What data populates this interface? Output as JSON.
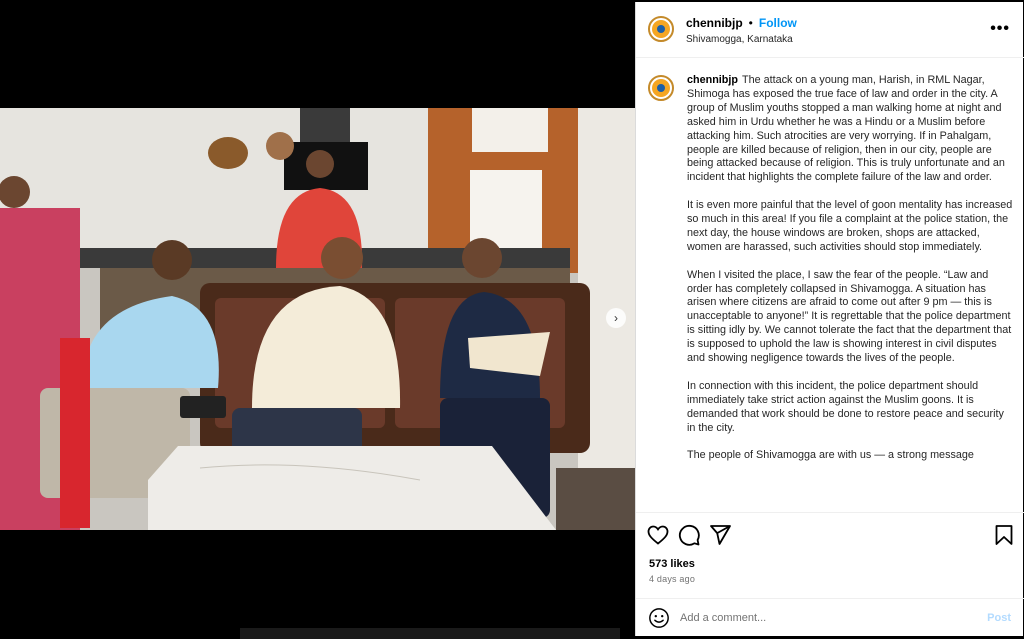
{
  "post": {
    "username": "chennibjp",
    "separator": "•",
    "follow_label": "Follow",
    "location": "Shivamogga, Karnataka",
    "more_label": "•••"
  },
  "caption": {
    "username": "chennibjp",
    "paragraphs": [
      "The attack on a young man, Harish, in RML Nagar, Shimoga has exposed the true face of law and order in the city. A group of Muslim youths stopped a man walking home at night and asked him in Urdu whether he was a Hindu or a Muslim before attacking him. Such atrocities are very worrying. If in Pahalgam, people are killed because of religion, then in our city, people are being attacked because of religion. This is truly unfortunate and an incident that highlights the complete failure of the law and order.",
      "It is even more painful that the level of goon mentality has increased so much in this area! If you file a complaint at the police station, the next day, the house windows are broken, shops are attacked, women are harassed, such activities should stop immediately.",
      "When I visited the place, I saw the fear of the people. “Law and order has completely collapsed in Shivamogga. A situation has arisen where citizens are afraid to come out after 9 pm — this is unacceptable to anyone!” It is regrettable that the police department is sitting idly by. We cannot tolerate the fact that the department that is supposed to uphold the law is showing interest in civil disputes and showing negligence towards the lives of the people.",
      "In connection with this incident, the police department should immediately take strict action against the Muslim goons. It is demanded that work should be done to restore peace and security in the city.",
      "The people of Shivamogga are with us — a strong message"
    ]
  },
  "actions": {
    "icons": [
      "heart-icon",
      "comment-icon",
      "share-icon",
      "bookmark-icon"
    ],
    "likes": "573 likes",
    "time": "4 days ago"
  },
  "comment": {
    "placeholder": "Add a comment...",
    "post_label": "Post"
  },
  "media": {
    "next_label": "›"
  }
}
